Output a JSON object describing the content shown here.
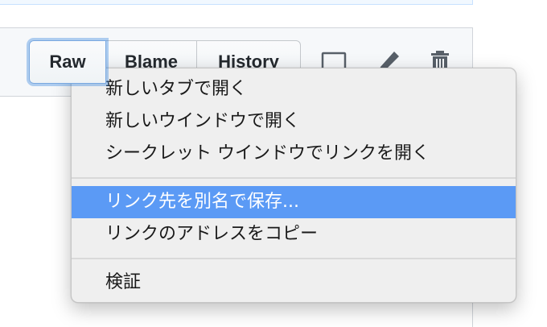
{
  "toolbar": {
    "raw_label": "Raw",
    "blame_label": "Blame",
    "history_label": "History",
    "icons": [
      "desktop-icon",
      "pencil-icon",
      "trash-icon"
    ]
  },
  "context_menu": {
    "groups": [
      {
        "items": [
          {
            "label": "新しいタブで開く"
          },
          {
            "label": "新しいウインドウで開く"
          },
          {
            "label": "シークレット ウインドウでリンクを開く"
          }
        ]
      },
      {
        "items": [
          {
            "label": "リンク先を別名で保存...",
            "highlighted": true
          },
          {
            "label": "リンクのアドレスをコピー"
          }
        ]
      },
      {
        "items": [
          {
            "label": "検証"
          }
        ]
      }
    ]
  },
  "colors": {
    "highlight": "#5b9af5",
    "menu_background": "#efefef",
    "header_background": "#f6f8fa",
    "focus_ring": "#7aa9e0"
  }
}
